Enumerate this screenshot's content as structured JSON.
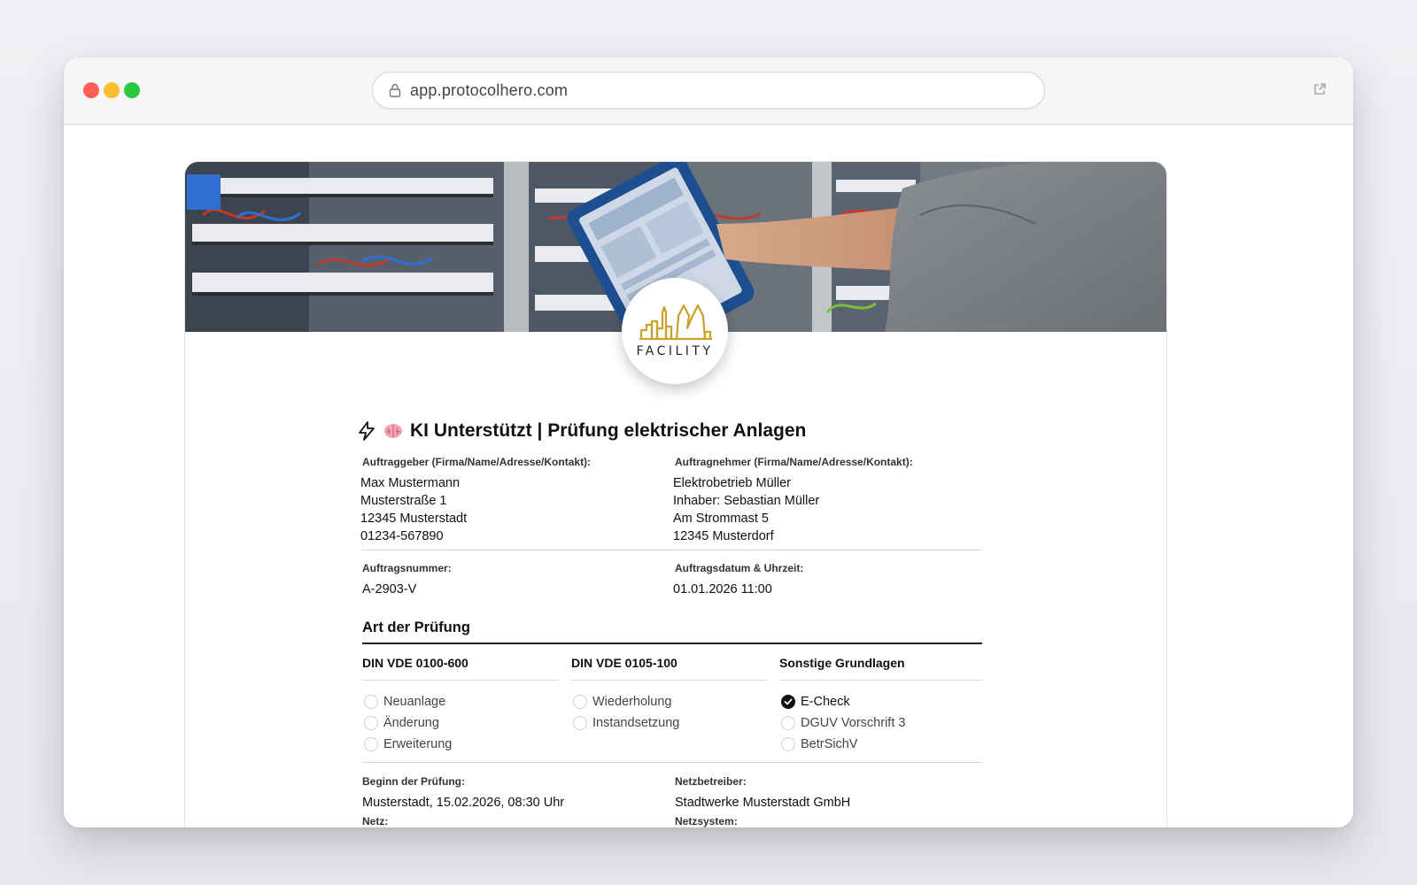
{
  "browser": {
    "url": "app.protocolhero.com"
  },
  "logo": {
    "text": "FACILITY"
  },
  "form": {
    "title": "KI Unterstützt | Prüfung elektrischer Anlagen",
    "auftraggeber": {
      "label": "Auftraggeber (Firma/Name/Adresse/Kontakt):",
      "lines": [
        "Max Mustermann",
        "Musterstraße 1",
        "12345 Musterstadt",
        "01234-567890"
      ]
    },
    "auftragnehmer": {
      "label": "Auftragnehmer (Firma/Name/Adresse/Kontakt):",
      "lines": [
        "Elektrobetrieb Müller",
        "Inhaber: Sebastian Müller",
        "Am Strommast 5",
        "12345 Musterdorf"
      ]
    },
    "auftragsnummer": {
      "label": "Auftragsnummer:",
      "value": "A-2903-V"
    },
    "auftragsdatum": {
      "label": "Auftragsdatum & Uhrzeit:",
      "value": "01.01.2026 11:00"
    },
    "art": {
      "title": "Art der Prüfung",
      "columns": [
        {
          "heading": "DIN VDE 0100-600",
          "options": [
            {
              "label": "Neuanlage",
              "checked": false
            },
            {
              "label": "Änderung",
              "checked": false
            },
            {
              "label": "Erweiterung",
              "checked": false
            }
          ]
        },
        {
          "heading": "DIN VDE 0105-100",
          "options": [
            {
              "label": "Wiederholung",
              "checked": false
            },
            {
              "label": "Instandsetzung",
              "checked": false
            }
          ]
        },
        {
          "heading": "Sonstige Grundlagen",
          "options": [
            {
              "label": "E-Check",
              "checked": true
            },
            {
              "label": "DGUV Vorschrift 3",
              "checked": false
            },
            {
              "label": "BetrSichV",
              "checked": false
            }
          ]
        }
      ]
    },
    "beginn": {
      "label": "Beginn der Prüfung:",
      "value": "Musterstadt, 15.02.2026, 08:30 Uhr"
    },
    "netzbetreiber": {
      "label": "Netzbetreiber:",
      "value": "Stadtwerke Musterstadt GmbH"
    },
    "netz": {
      "label": "Netz:"
    },
    "netzsystem": {
      "label": "Netzsystem:"
    }
  },
  "colors": {
    "accent": "#111111",
    "logo_gold": "#c9a227"
  }
}
